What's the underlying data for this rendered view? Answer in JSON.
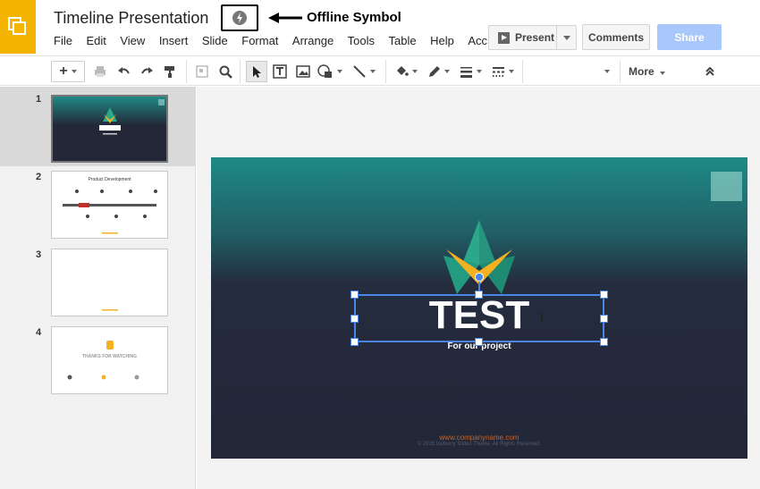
{
  "app": {
    "logo_icon": "slides-logo-icon",
    "logo_color": "#f4b400"
  },
  "document": {
    "title": "Timeline Presentation"
  },
  "annotation": {
    "label": "Offline Symbol",
    "icon": "offline-bolt-icon"
  },
  "menu": [
    "File",
    "Edit",
    "View",
    "Insert",
    "Slide",
    "Format",
    "Arrange",
    "Tools",
    "Table",
    "Help",
    "Acc"
  ],
  "header_buttons": {
    "present": "Present",
    "comments": "Comments",
    "share": "Share"
  },
  "toolbar": {
    "more_label": "More"
  },
  "filmstrip": {
    "slides": [
      {
        "number": "1",
        "selected": true
      },
      {
        "number": "2",
        "title": "Product Development"
      },
      {
        "number": "3"
      },
      {
        "number": "4",
        "title": "THANKS FOR WATCHING"
      }
    ]
  },
  "slide": {
    "title": "TEST",
    "subtitle": "For our project",
    "url": "www.companyname.com",
    "copyright": "© 2015 Iceberry Slides Theme. All Rights Reserved.",
    "accent_colors": [
      "#2aa889",
      "#f5b120",
      "#232738"
    ]
  }
}
